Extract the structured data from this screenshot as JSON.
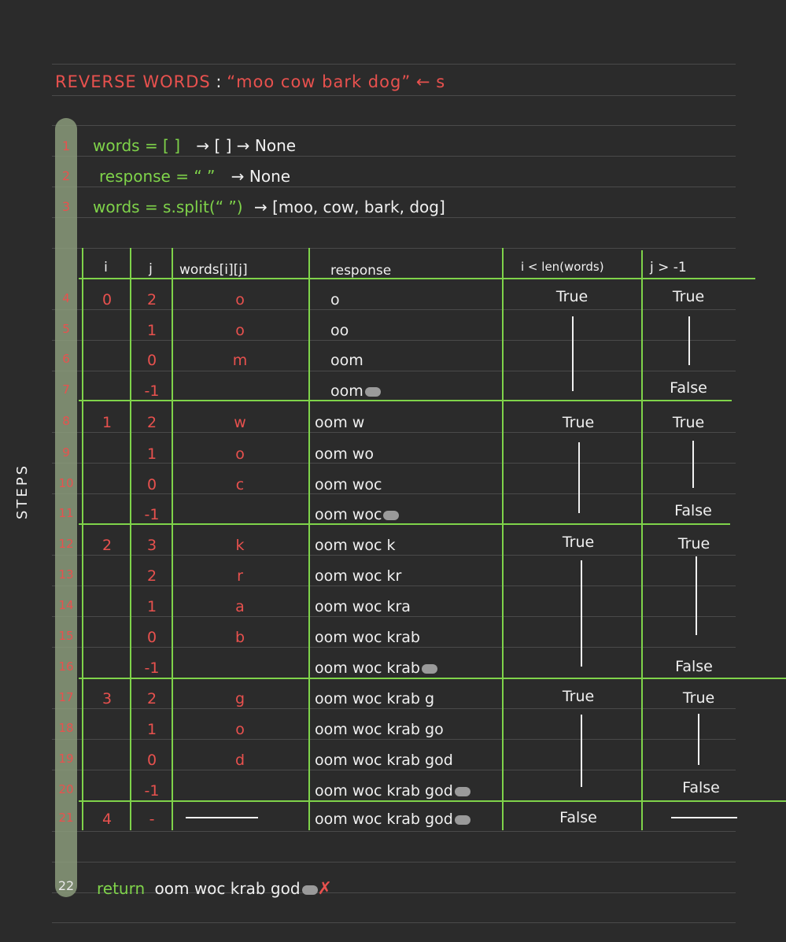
{
  "title": {
    "label": "REVERSE WORDS",
    "colon": " : ",
    "string": "“moo cow bark dog”",
    "arrow": "←",
    "var": "s"
  },
  "steps_label": "STEPS",
  "code": [
    {
      "n": "1",
      "kw": "words = [ ]",
      "rest": "→ [ ] → None"
    },
    {
      "n": "2",
      "kw": "response = “ ”",
      "rest": "→ None"
    },
    {
      "n": "3",
      "kw": "words = s.split(“ ”)",
      "rest": "→ [moo, cow, bark, dog]"
    }
  ],
  "table": {
    "headers": {
      "i": "i",
      "j": "j",
      "w": "words[i][j]",
      "r": "response",
      "b1": "i < len(words)",
      "b2": "j > -1"
    },
    "rows": [
      {
        "n": "4",
        "i": "0",
        "j": "2",
        "w": "o",
        "r": "o",
        "dot": false
      },
      {
        "n": "5",
        "i": "",
        "j": "1",
        "w": "o",
        "r": "oo",
        "dot": false
      },
      {
        "n": "6",
        "i": "",
        "j": "0",
        "w": "m",
        "r": "oom",
        "dot": false
      },
      {
        "n": "7",
        "i": "",
        "j": "-1",
        "w": "",
        "r": "oom",
        "dot": true
      },
      {
        "n": "8",
        "i": "1",
        "j": "2",
        "w": "w",
        "r": "oom w",
        "dot": false
      },
      {
        "n": "9",
        "i": "",
        "j": "1",
        "w": "o",
        "r": "oom wo",
        "dot": false
      },
      {
        "n": "10",
        "i": "",
        "j": "0",
        "w": "c",
        "r": "oom woc",
        "dot": false
      },
      {
        "n": "11",
        "i": "",
        "j": "-1",
        "w": "",
        "r": "oom woc",
        "dot": true
      },
      {
        "n": "12",
        "i": "2",
        "j": "3",
        "w": "k",
        "r": "oom woc k",
        "dot": false
      },
      {
        "n": "13",
        "i": "",
        "j": "2",
        "w": "r",
        "r": "oom woc kr",
        "dot": false
      },
      {
        "n": "14",
        "i": "",
        "j": "1",
        "w": "a",
        "r": "oom woc kra",
        "dot": false
      },
      {
        "n": "15",
        "i": "",
        "j": "0",
        "w": "b",
        "r": "oom woc krab",
        "dot": false
      },
      {
        "n": "16",
        "i": "",
        "j": "-1",
        "w": "",
        "r": "oom woc krab",
        "dot": true
      },
      {
        "n": "17",
        "i": "3",
        "j": "2",
        "w": "g",
        "r": "oom woc krab g",
        "dot": false
      },
      {
        "n": "18",
        "i": "",
        "j": "1",
        "w": "o",
        "r": "oom woc krab go",
        "dot": false
      },
      {
        "n": "19",
        "i": "",
        "j": "0",
        "w": "d",
        "r": "oom woc krab god",
        "dot": false
      },
      {
        "n": "20",
        "i": "",
        "j": "-1",
        "w": "",
        "r": "oom woc krab god",
        "dot": true
      },
      {
        "n": "21",
        "i": "4",
        "j": "-",
        "w": "",
        "r": "oom woc krab god",
        "dot": true
      }
    ],
    "bools": {
      "true": "True",
      "false": "False"
    }
  },
  "final": {
    "n": "22",
    "kw": "return",
    "text": "oom woc krab god",
    "x": "✗"
  }
}
